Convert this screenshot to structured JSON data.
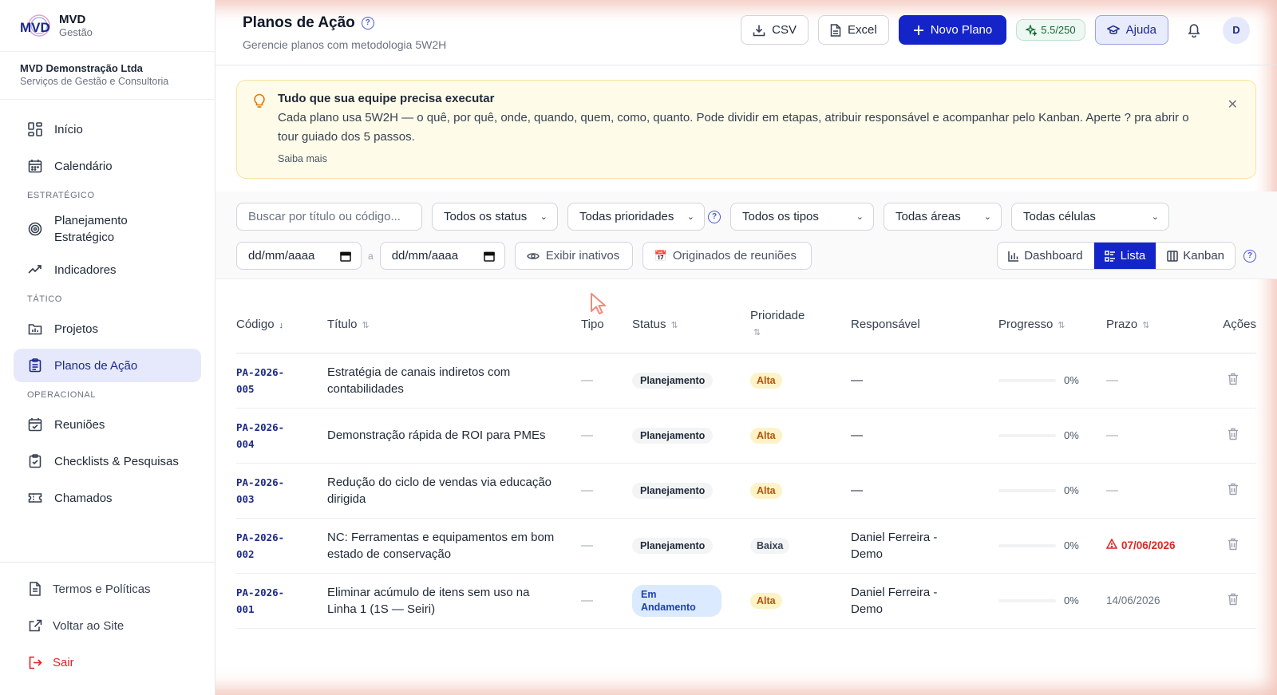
{
  "brand": {
    "name": "MVD",
    "subtitle": "Gestão"
  },
  "org": {
    "name": "MVD Demonstração Ltda",
    "desc": "Serviços de Gestão e Consultoria"
  },
  "nav": {
    "inicio": "Início",
    "calendario": "Calendário",
    "sec_estrategico": "ESTRATÉGICO",
    "planejamento_l1": "Planejamento",
    "planejamento_l2": "Estratégico",
    "indicadores": "Indicadores",
    "sec_tatico": "TÁTICO",
    "projetos": "Projetos",
    "planos": "Planos de Ação",
    "sec_operacional": "OPERACIONAL",
    "reunioes": "Reuniões",
    "checklists": "Checklists & Pesquisas",
    "chamados": "Chamados"
  },
  "bottom_nav": {
    "termos": "Termos e Políticas",
    "voltar": "Voltar ao Site",
    "sair": "Sair"
  },
  "header": {
    "title": "Planos de Ação",
    "subtitle": "Gerencie planos com metodologia 5W2H",
    "help_glyph": "?",
    "csv": "CSV",
    "excel": "Excel",
    "novo": "Novo Plano",
    "usage": "5.5/250",
    "ajuda": "Ajuda",
    "avatar": "D"
  },
  "banner": {
    "title": "Tudo que sua equipe precisa executar",
    "text": "Cada plano usa 5W2H — o quê, por quê, onde, quando, quem, como, quanto. Pode dividir em etapas, atribuir responsável e acompanhar pelo Kanban. Aperte ? pra abrir o tour guiado dos 5 passos.",
    "more": "Saiba mais",
    "close": "✕"
  },
  "filters": {
    "search_placeholder": "Buscar por título ou código...",
    "status": "Todos os status",
    "prioridades": "Todas prioridades",
    "tipos": "Todos os tipos",
    "areas": "Todas áreas",
    "celulas": "Todas células",
    "date_from": "dd/mm/aaaa",
    "date_sep": "a",
    "date_to": "dd/mm/aaaa",
    "inativos": "Exibir inativos",
    "originados": "Originados de reuniões",
    "originados_icon": "📅"
  },
  "views": {
    "dashboard": "Dashboard",
    "lista": "Lista",
    "kanban": "Kanban"
  },
  "table": {
    "headers": {
      "codigo": "Código",
      "titulo": "Título",
      "tipo": "Tipo",
      "status": "Status",
      "prioridade": "Prioridade",
      "responsavel": "Responsável",
      "progresso": "Progresso",
      "prazo": "Prazo",
      "acoes": "Ações"
    },
    "rows": [
      {
        "code1": "PA-2026-",
        "code2": "005",
        "title": "Estratégia de canais indiretos com contabilidades",
        "tipo": "—",
        "status": "Planejamento",
        "prioridade": "Alta",
        "resp": "—",
        "progress": 0,
        "pct": "0%",
        "prazo": "—"
      },
      {
        "code1": "PA-2026-",
        "code2": "004",
        "title": "Demonstração rápida de ROI para PMEs",
        "tipo": "—",
        "status": "Planejamento",
        "prioridade": "Alta",
        "resp": "—",
        "progress": 0,
        "pct": "0%",
        "prazo": "—"
      },
      {
        "code1": "PA-2026-",
        "code2": "003",
        "title": "Redução do ciclo de vendas via educação dirigida",
        "tipo": "—",
        "status": "Planejamento",
        "prioridade": "Alta",
        "resp": "—",
        "progress": 0,
        "pct": "0%",
        "prazo": "—"
      },
      {
        "code1": "PA-2026-",
        "code2": "002",
        "title": "NC: Ferramentas e equipamentos em bom estado de conservação",
        "tipo": "—",
        "status": "Planejamento",
        "prioridade": "Baixa",
        "resp": "Daniel Ferreira - Demo",
        "progress": 0,
        "pct": "0%",
        "prazo": "07/06/2026"
      },
      {
        "code1": "PA-2026-",
        "code2": "001",
        "title": "Eliminar acúmulo de itens sem uso na Linha 1 (1S — Seiri)",
        "tipo": "—",
        "status": "Em Andamento",
        "prioridade": "Alta",
        "resp": "Daniel Ferreira - Demo",
        "progress": 0,
        "pct": "0%",
        "prazo": "14/06/2026"
      }
    ]
  },
  "colors": {
    "primary": "#1424c8",
    "active_nav": "#e6e9fb",
    "danger": "#dc2626",
    "banner_bg": "#fefbe9"
  }
}
